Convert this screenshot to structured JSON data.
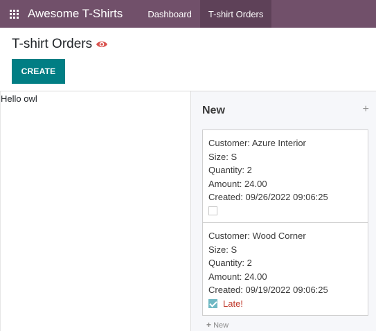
{
  "navbar": {
    "brand": "Awesome T-Shirts",
    "items": [
      {
        "label": "Dashboard",
        "active": false
      },
      {
        "label": "T-shirt Orders",
        "active": true
      }
    ]
  },
  "control_panel": {
    "title": "T-shirt Orders",
    "create_label": "CREATE"
  },
  "main": {
    "left_text": "Hello owl"
  },
  "kanban": {
    "column_title": "New",
    "add_symbol": "+",
    "quick_create_label": "New",
    "cards": [
      {
        "customer": "Customer: Azure Interior",
        "size": "Size: S",
        "quantity": "Quantity: 2",
        "amount": "Amount: 24.00",
        "created": "Created: 09/26/2022 09:06:25",
        "checked": false,
        "late_label": ""
      },
      {
        "customer": "Customer: Wood Corner",
        "size": "Size: S",
        "quantity": "Quantity: 2",
        "amount": "Amount: 24.00",
        "created": "Created: 09/19/2022 09:06:25",
        "checked": true,
        "late_label": "Late!"
      }
    ]
  },
  "colors": {
    "navbar": "#71506a",
    "primary": "#017e84",
    "late": "#c0392b",
    "eye": "#d9534f"
  },
  "icons": {
    "apps": "apps-grid-icon",
    "eye": "eye-icon",
    "add": "plus-icon"
  }
}
